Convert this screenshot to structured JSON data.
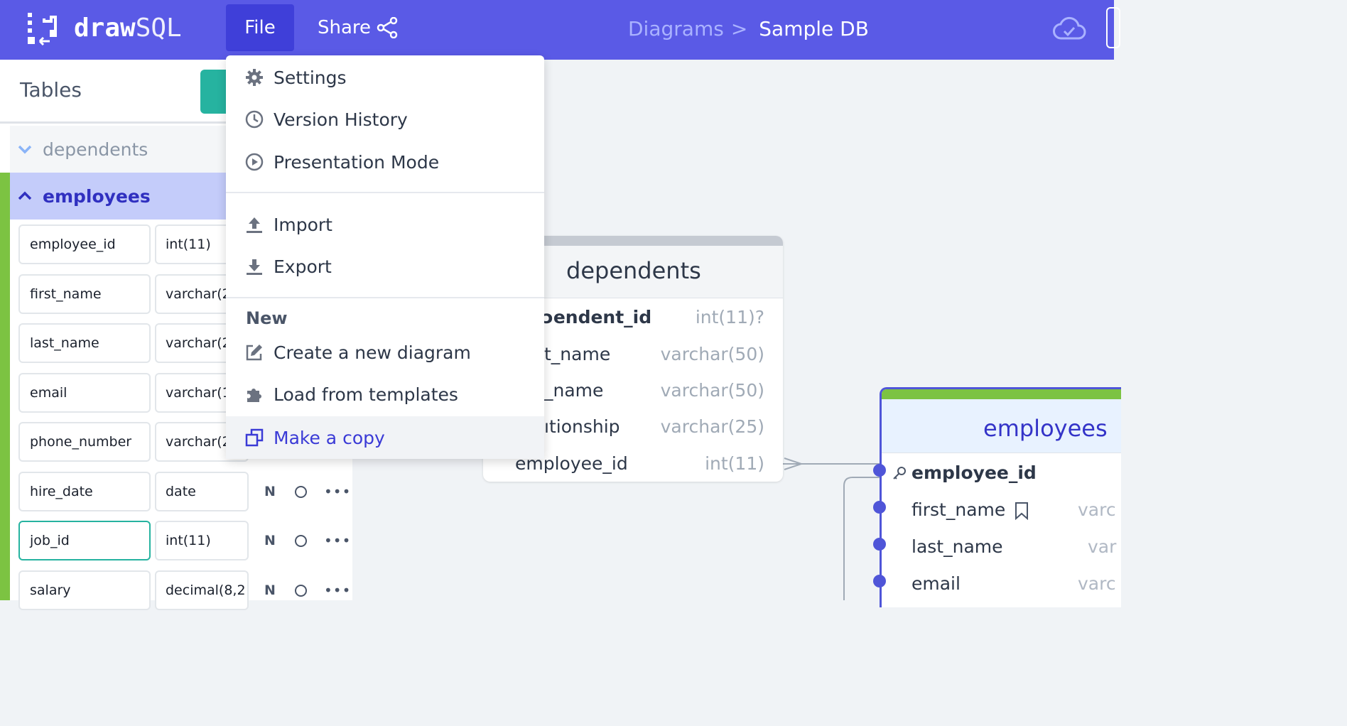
{
  "header": {
    "logo_bold": "draw",
    "logo_light": "SQL",
    "file_label": "File",
    "share_label": "Share",
    "breadcrumb_parent": "Diagrams",
    "breadcrumb_sep": ">",
    "breadcrumb_current": "Sample DB"
  },
  "sidebar": {
    "title": "Tables",
    "tables": [
      {
        "name": "dependents",
        "expanded": false
      },
      {
        "name": "employees",
        "expanded": true
      }
    ],
    "columns": [
      {
        "name": "employee_id",
        "type": "int(11)",
        "flag": ""
      },
      {
        "name": "first_name",
        "type": "varchar(2",
        "flag": ""
      },
      {
        "name": "last_name",
        "type": "varchar(2",
        "flag": ""
      },
      {
        "name": "email",
        "type": "varchar(1",
        "flag": ""
      },
      {
        "name": "phone_number",
        "type": "varchar(2",
        "flag": ""
      },
      {
        "name": "hire_date",
        "type": "date",
        "flag": "N"
      },
      {
        "name": "job_id",
        "type": "int(11)",
        "flag": "N"
      },
      {
        "name": "salary",
        "type": "decimal(8,2",
        "flag": "N"
      }
    ]
  },
  "file_menu": {
    "settings": "Settings",
    "version_history": "Version History",
    "presentation_mode": "Presentation Mode",
    "import": "Import",
    "export": "Export",
    "new_section": "New",
    "create_new": "Create a new diagram",
    "load_templates": "Load from templates",
    "make_copy": "Make a copy"
  },
  "canvas": {
    "dependents_card": {
      "title": "dependents",
      "fields": [
        {
          "name": "ɔendent_id",
          "type": "int(11)?",
          "bold": true
        },
        {
          "name": "t_name",
          "type": "varchar(50)"
        },
        {
          "name": "_name",
          "type": "varchar(50)"
        },
        {
          "name": "ıtionship",
          "type": "varchar(25)"
        },
        {
          "name": "employee_id",
          "type": "int(11)"
        }
      ]
    },
    "employees_card": {
      "title": "employees",
      "fields": [
        {
          "name": "employee_id",
          "type": "",
          "pk": true
        },
        {
          "name": "first_name",
          "type": "varc"
        },
        {
          "name": "last_name",
          "type": "var"
        },
        {
          "name": "email",
          "type": "varc"
        }
      ]
    }
  },
  "colors": {
    "header_bg": "#5a5ae6",
    "accent": "#3a3ad6",
    "teal": "#26b3a0",
    "green": "#7cc342"
  }
}
